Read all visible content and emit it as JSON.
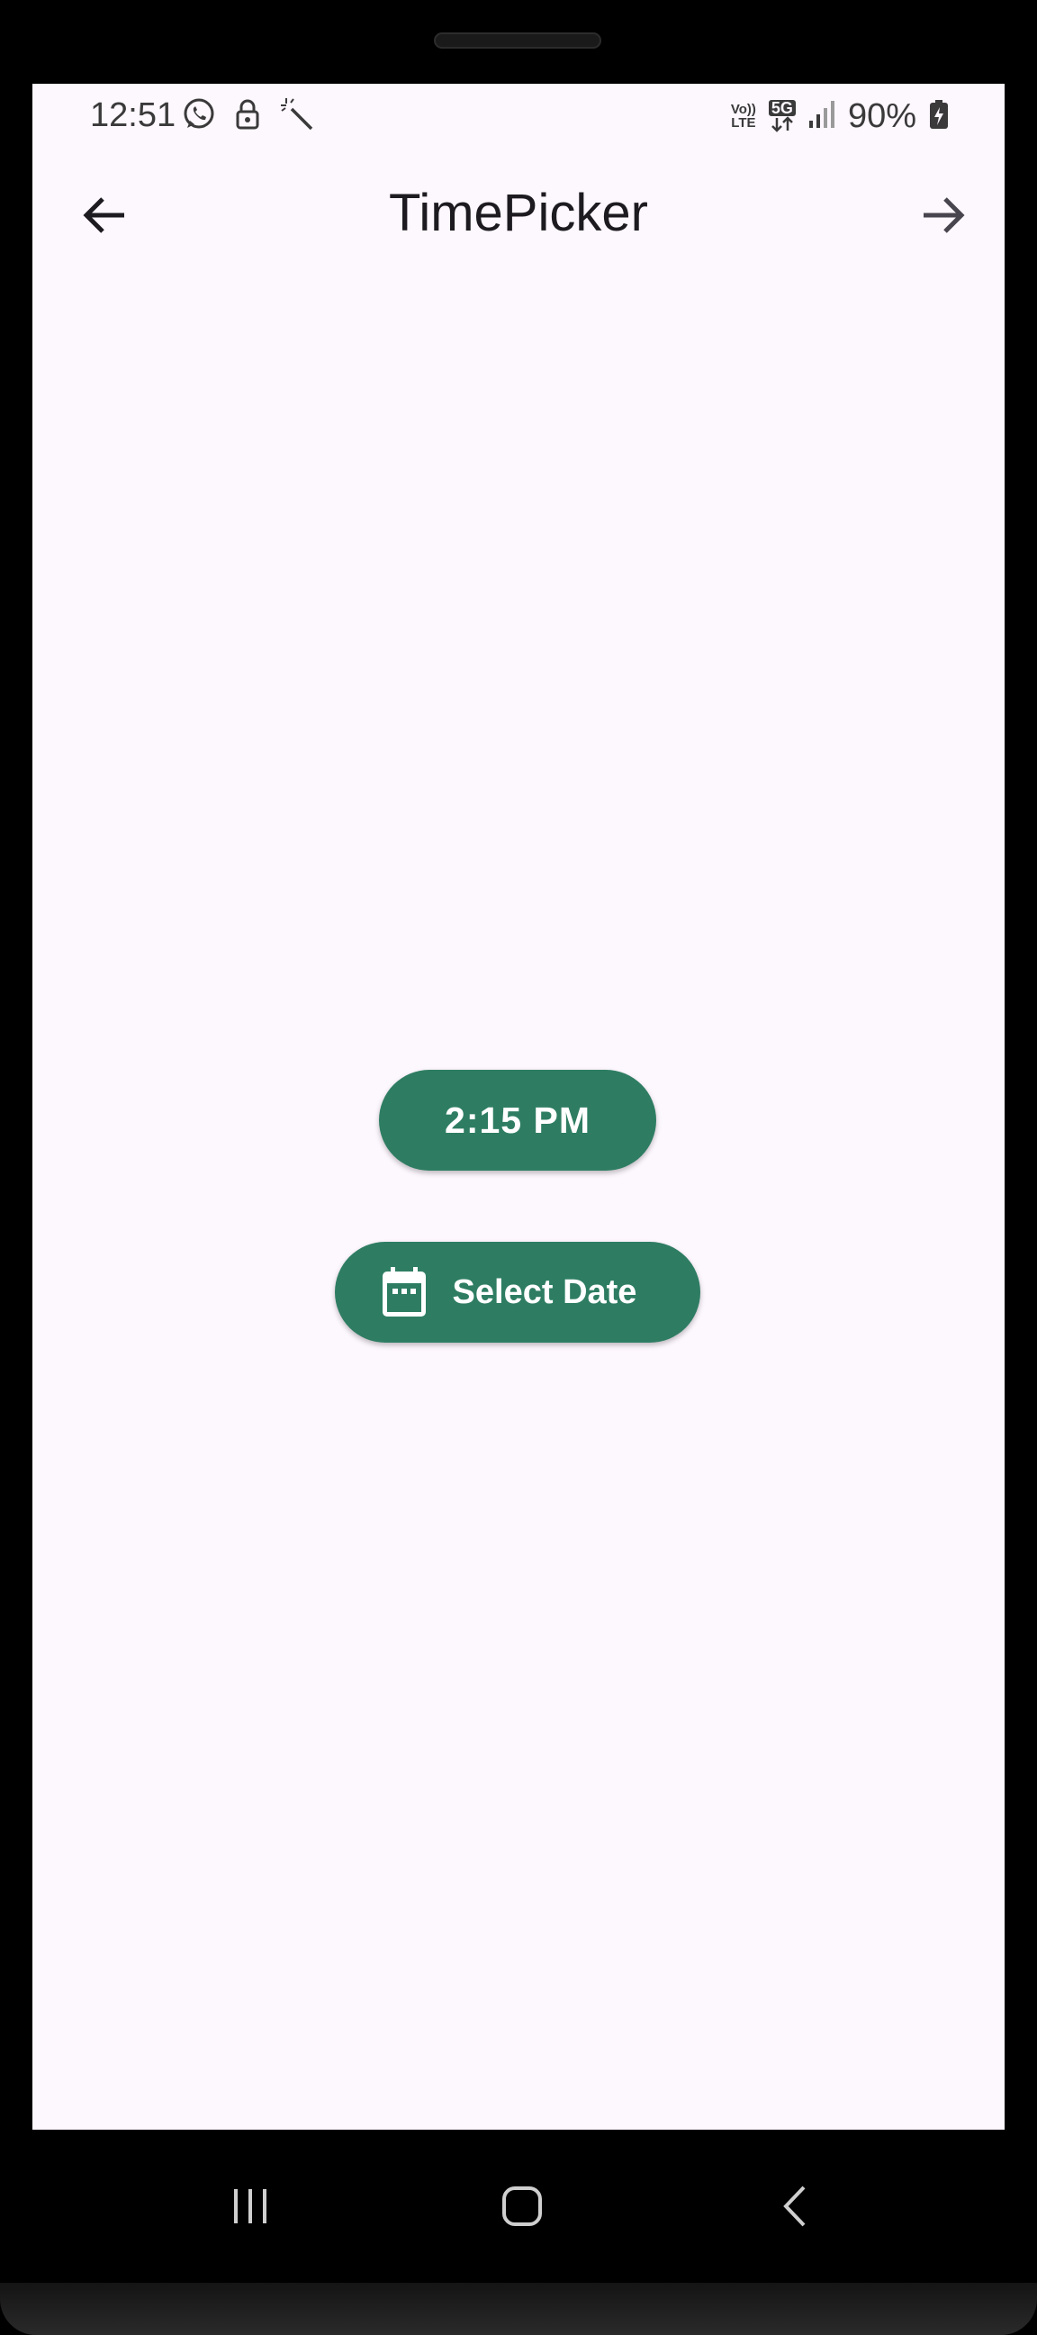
{
  "status_bar": {
    "time": "12:51",
    "battery_percent": "90%",
    "network_label": "5G",
    "volte_label_top": "Vo))",
    "volte_label_bottom": "LTE",
    "icons": [
      "whatsapp-icon",
      "lock-icon",
      "magic-wand-icon",
      "volte-icon",
      "5g-icon",
      "signal-icon",
      "battery-charging-icon"
    ]
  },
  "app_bar": {
    "title": "TimePicker",
    "back_icon": "arrow-back-icon",
    "forward_icon": "arrow-forward-icon"
  },
  "main": {
    "time_button_label": "2:15 PM",
    "date_button_label": "Select Date",
    "date_button_icon": "calendar-icon"
  },
  "colors": {
    "background": "#fdf7fe",
    "button": "#2e7d62",
    "button_text": "#ffffff",
    "title_text": "#1d1b20"
  },
  "system_nav": {
    "icons": [
      "recent-apps-icon",
      "home-icon",
      "back-icon"
    ]
  }
}
